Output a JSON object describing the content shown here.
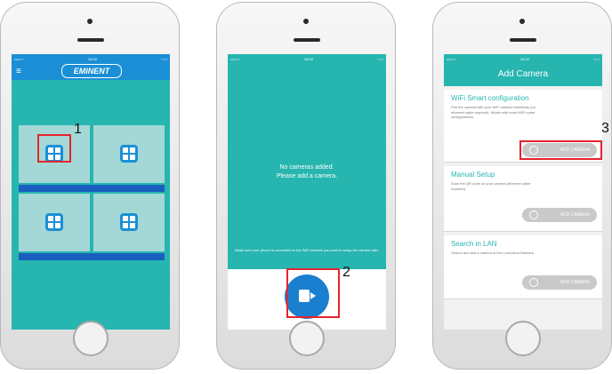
{
  "phones": {
    "p1": {
      "status": {
        "carrier": "••••• ≈",
        "time": "16:00",
        "battery": "▪ ▪ ▪"
      },
      "menu_icon": "≡",
      "brand": "EMINENT"
    },
    "p2": {
      "status": {
        "carrier": "••••• ≈",
        "time": "16:00",
        "battery": "▪ ▪ ▪"
      },
      "empty_line1": "No cameras added.",
      "empty_line2": "Please add a camera.",
      "hint": "Make sure your phone is connected to the WiFi network you want to setup the camera with.",
      "add_label": "Add Camera"
    },
    "p3": {
      "status": {
        "carrier": "••••• ≈",
        "time": "16:00",
        "battery": "▪ ▪ ▪"
      },
      "title": "Add Camera",
      "sections": [
        {
          "title": "WiFi Smart configuration",
          "desc": "Pair the camera with your WiFi network wirelessly (no ethernet cable required). Works with most WiFi router configurations.",
          "button": "ADD CAMERA"
        },
        {
          "title": "Manual Setup",
          "desc": "Scan the QR code on your camera (ethernet cable required).",
          "button": "ADD CAMERA"
        },
        {
          "title": "Search in LAN",
          "desc": "Search and add a camera in the Local Area Network.",
          "button": "ADD CAMERA"
        }
      ]
    }
  },
  "annotations": {
    "step1": "1",
    "step2": "2",
    "step3": "3"
  },
  "colors": {
    "teal": "#27b5b0",
    "blue": "#1a8fd6",
    "band": "#1a5fbf",
    "highlight": "#e6232d"
  }
}
